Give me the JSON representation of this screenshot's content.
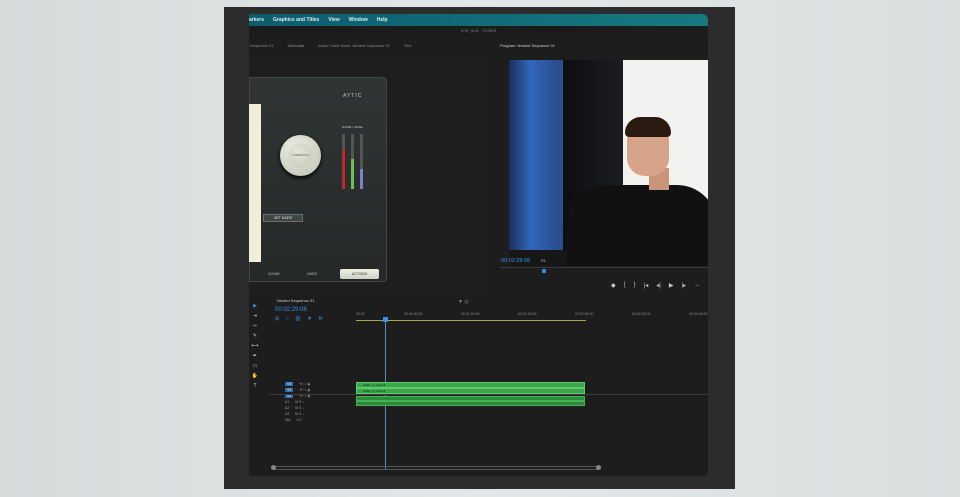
{
  "menu": [
    "arkers",
    "Graphics and Titles",
    "View",
    "Window",
    "Help"
  ],
  "window_title": "test_autc - Edited",
  "source_tabs": [
    "Sequence 01",
    "Metadata",
    "Audio Track Mixer: Nested Sequence 01",
    "Text"
  ],
  "program_monitor": {
    "title": "Program: Nested Sequence 01",
    "timecode": "00:02:29:08",
    "fit": "Fit",
    "controls": [
      "◆",
      "{",
      "}",
      "|◂",
      "◂|",
      "▶",
      "|▸",
      "→"
    ]
  },
  "plugin": {
    "logo": "AYTIC",
    "meter_label": "NOISE / LEVEL",
    "knob_label": "STRENGTH",
    "get_more": "GET MORE",
    "clear": "CLEAR",
    "undo": "UNDO",
    "actions": "ACTIONS",
    "meter_colors": [
      "#c0272d",
      "#6fbf5a",
      "#7e7ed0"
    ]
  },
  "timeline": {
    "tab": "Nested Sequence 01",
    "timecode": "00:02:29:08",
    "ruler": [
      "00:00",
      "00:00:30:00",
      "00:01:00:00",
      "00:01:30:00",
      "00:02:00:00",
      "00:02:30:00",
      "00:03:00:00"
    ],
    "tracks": [
      {
        "name": "V3",
        "icons": "⟲ ☐ ◉"
      },
      {
        "name": "V2",
        "icons": "⟲ ☐ ◉"
      },
      {
        "name": "V1",
        "icons": "⟲ ☐ ◉"
      },
      {
        "name": "A1",
        "icons": "M S ♩"
      },
      {
        "name": "A2",
        "icons": "M S ♩"
      },
      {
        "name": "A3",
        "icons": "M S ♩"
      },
      {
        "name": "Mix",
        "icons": "0.0"
      }
    ],
    "clips": [
      "Audio_1_nest.v2",
      "Audio_1_nest.v2"
    ]
  }
}
